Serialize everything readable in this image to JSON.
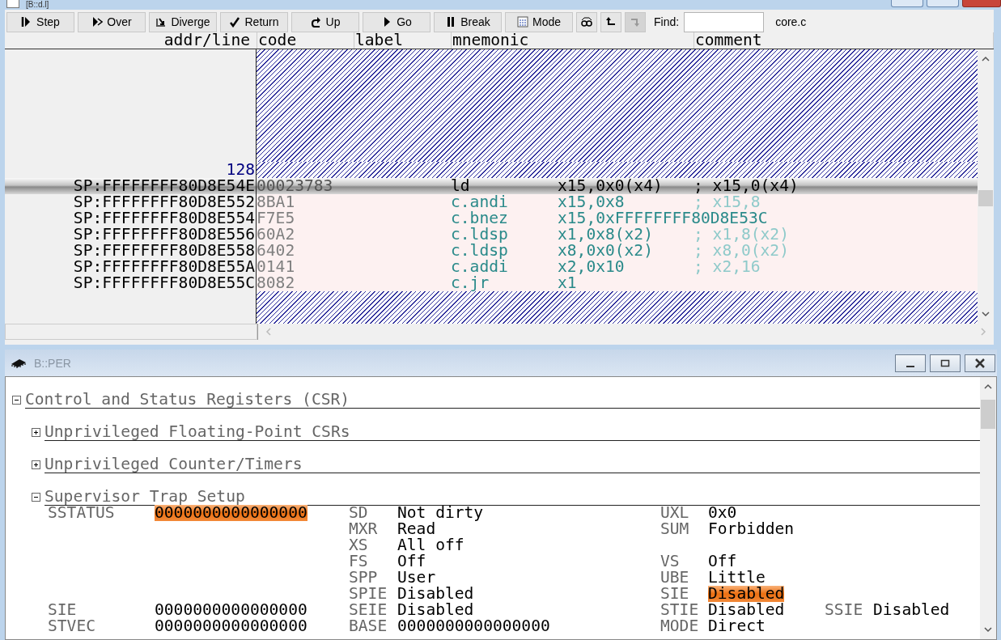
{
  "window": {
    "title": "[B::d.l]"
  },
  "toolbar": {
    "buttons": [
      {
        "label": "Step",
        "disabled": false
      },
      {
        "label": "Over",
        "disabled": false
      },
      {
        "label": "Diverge",
        "disabled": false
      },
      {
        "label": "Return",
        "disabled": false
      },
      {
        "label": "Up",
        "disabled": false
      },
      {
        "label": "Go",
        "disabled": false
      },
      {
        "label": "Break",
        "disabled": false
      },
      {
        "label": "Mode",
        "disabled": false
      },
      {
        "disabled": false
      },
      {
        "disabled": false
      },
      {
        "disabled": true
      }
    ],
    "find": {
      "label": "Find:"
    },
    "file": "core.c"
  },
  "listing": {
    "columns": [
      "addr/line",
      "code",
      "label",
      "mnemonic",
      "comment"
    ],
    "rows": [
      {
        "kind": "line",
        "line": "128"
      },
      {
        "kind": "code",
        "selected": true,
        "addr": "SP:FFFFFFFF80D8E54E",
        "code": "00023783",
        "mnemonic": "ld",
        "operands": "x15,0x0(x4)",
        "comment": "; x15,0(x4)"
      },
      {
        "kind": "code",
        "selected": false,
        "addr": "SP:FFFFFFFF80D8E552",
        "code": "8BA1",
        "mnemonic": "c.andi",
        "operands": "x15,0x8",
        "comment": "; x15,8"
      },
      {
        "kind": "code",
        "selected": false,
        "addr": "SP:FFFFFFFF80D8E554",
        "code": "F7E5",
        "mnemonic": "c.bnez",
        "operands": "x15,0xFFFFFFFF80D8E53C"
      },
      {
        "kind": "code",
        "selected": false,
        "addr": "SP:FFFFFFFF80D8E556",
        "code": "60A2",
        "mnemonic": "c.ldsp",
        "operands": "x1,0x8(x2)",
        "comment": "; x1,8(x2)"
      },
      {
        "kind": "code",
        "selected": false,
        "addr": "SP:FFFFFFFF80D8E558",
        "code": "6402",
        "mnemonic": "c.ldsp",
        "operands": "x8,0x0(x2)",
        "comment": "; x8,0(x2)"
      },
      {
        "kind": "code",
        "selected": false,
        "addr": "SP:FFFFFFFF80D8E55A",
        "code": "0141",
        "mnemonic": "c.addi",
        "operands": "x2,0x10",
        "comment": "; x2,16"
      },
      {
        "kind": "code",
        "selected": false,
        "addr": "SP:FFFFFFFF80D8E55C",
        "code": "8082",
        "mnemonic": "c.jr",
        "operands": "x1"
      }
    ]
  },
  "peripheral_window": {
    "title": "B::PER",
    "tree": [
      {
        "label": "Control and Status Registers (CSR)",
        "expanded": true,
        "children": [
          {
            "label": "Unprivileged Floating-Point CSRs",
            "expanded": false
          },
          {
            "label": "Unprivileged Counter/Timers",
            "expanded": false
          },
          {
            "label": "Supervisor Trap Setup",
            "expanded": true,
            "registers": [
              {
                "name": "SSTATUS",
                "value": "0000000000000000",
                "highlighted": true,
                "rows": [
                  {
                    "left": {
                      "name": "SD",
                      "value": "Not dirty",
                      "highlighted": false
                    },
                    "middle": {
                      "name": "UXL",
                      "value": "0x0",
                      "highlighted": false
                    }
                  },
                  {
                    "left": {
                      "name": "MXR",
                      "value": "Read",
                      "highlighted": false
                    },
                    "middle": {
                      "name": "SUM",
                      "value": "Forbidden",
                      "highlighted": false
                    }
                  },
                  {
                    "left": {
                      "name": "XS",
                      "value": "All off",
                      "highlighted": false
                    }
                  },
                  {
                    "left": {
                      "name": "FS",
                      "value": "Off",
                      "highlighted": false
                    },
                    "middle": {
                      "name": "VS",
                      "value": "Off",
                      "highlighted": false
                    }
                  },
                  {
                    "left": {
                      "name": "SPP",
                      "value": "User",
                      "highlighted": false
                    },
                    "middle": {
                      "name": "UBE",
                      "value": "Little",
                      "highlighted": false
                    }
                  },
                  {
                    "left": {
                      "name": "SPIE",
                      "value": "Disabled",
                      "highlighted": false
                    },
                    "middle": {
                      "name": "SIE",
                      "value": "Disabled",
                      "highlighted": true
                    }
                  }
                ]
              },
              {
                "name": "SIE",
                "value": "0000000000000000",
                "highlighted": false,
                "rows": [
                  {
                    "left": {
                      "name": "SEIE",
                      "value": "Disabled",
                      "highlighted": false
                    },
                    "middle": {
                      "name": "STIE",
                      "value": "Disabled",
                      "highlighted": false
                    },
                    "right": {
                      "name": "SSIE",
                      "value": "Disabled",
                      "highlighted": false
                    }
                  }
                ]
              },
              {
                "name": "STVEC",
                "value": "0000000000000000",
                "highlighted": false,
                "rows": [
                  {
                    "left": {
                      "name": "BASE",
                      "value": "0000000000000000",
                      "highlighted": false
                    },
                    "middle": {
                      "name": "MODE",
                      "value": "Direct",
                      "highlighted": false
                    }
                  }
                ]
              }
            ]
          }
        ]
      }
    ]
  }
}
